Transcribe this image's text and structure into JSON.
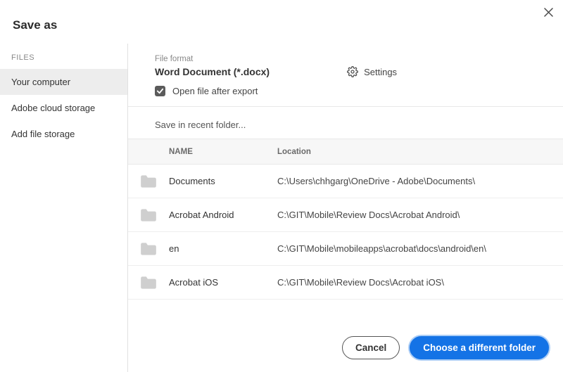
{
  "title": "Save as",
  "close_icon_label": "close",
  "sidebar": {
    "heading": "FILES",
    "items": [
      {
        "label": "Your computer",
        "selected": true
      },
      {
        "label": "Adobe cloud storage",
        "selected": false
      },
      {
        "label": "Add file storage",
        "selected": false
      }
    ]
  },
  "format": {
    "label": "File format",
    "value": "Word Document (*.docx)",
    "settings_label": "Settings",
    "open_after": {
      "checked": true,
      "label": "Open file after export"
    }
  },
  "recent": {
    "label": "Save in recent folder...",
    "columns": {
      "name": "NAME",
      "location": "Location"
    },
    "rows": [
      {
        "name": "Documents",
        "location": "C:\\Users\\chhgarg\\OneDrive - Adobe\\Documents\\"
      },
      {
        "name": "Acrobat Android",
        "location": "C:\\GIT\\Mobile\\Review Docs\\Acrobat Android\\"
      },
      {
        "name": "en",
        "location": "C:\\GIT\\Mobile\\mobileapps\\acrobat\\docs\\android\\en\\"
      },
      {
        "name": "Acrobat iOS",
        "location": "C:\\GIT\\Mobile\\Review Docs\\Acrobat iOS\\"
      }
    ]
  },
  "footer": {
    "cancel": "Cancel",
    "choose": "Choose a different folder"
  }
}
